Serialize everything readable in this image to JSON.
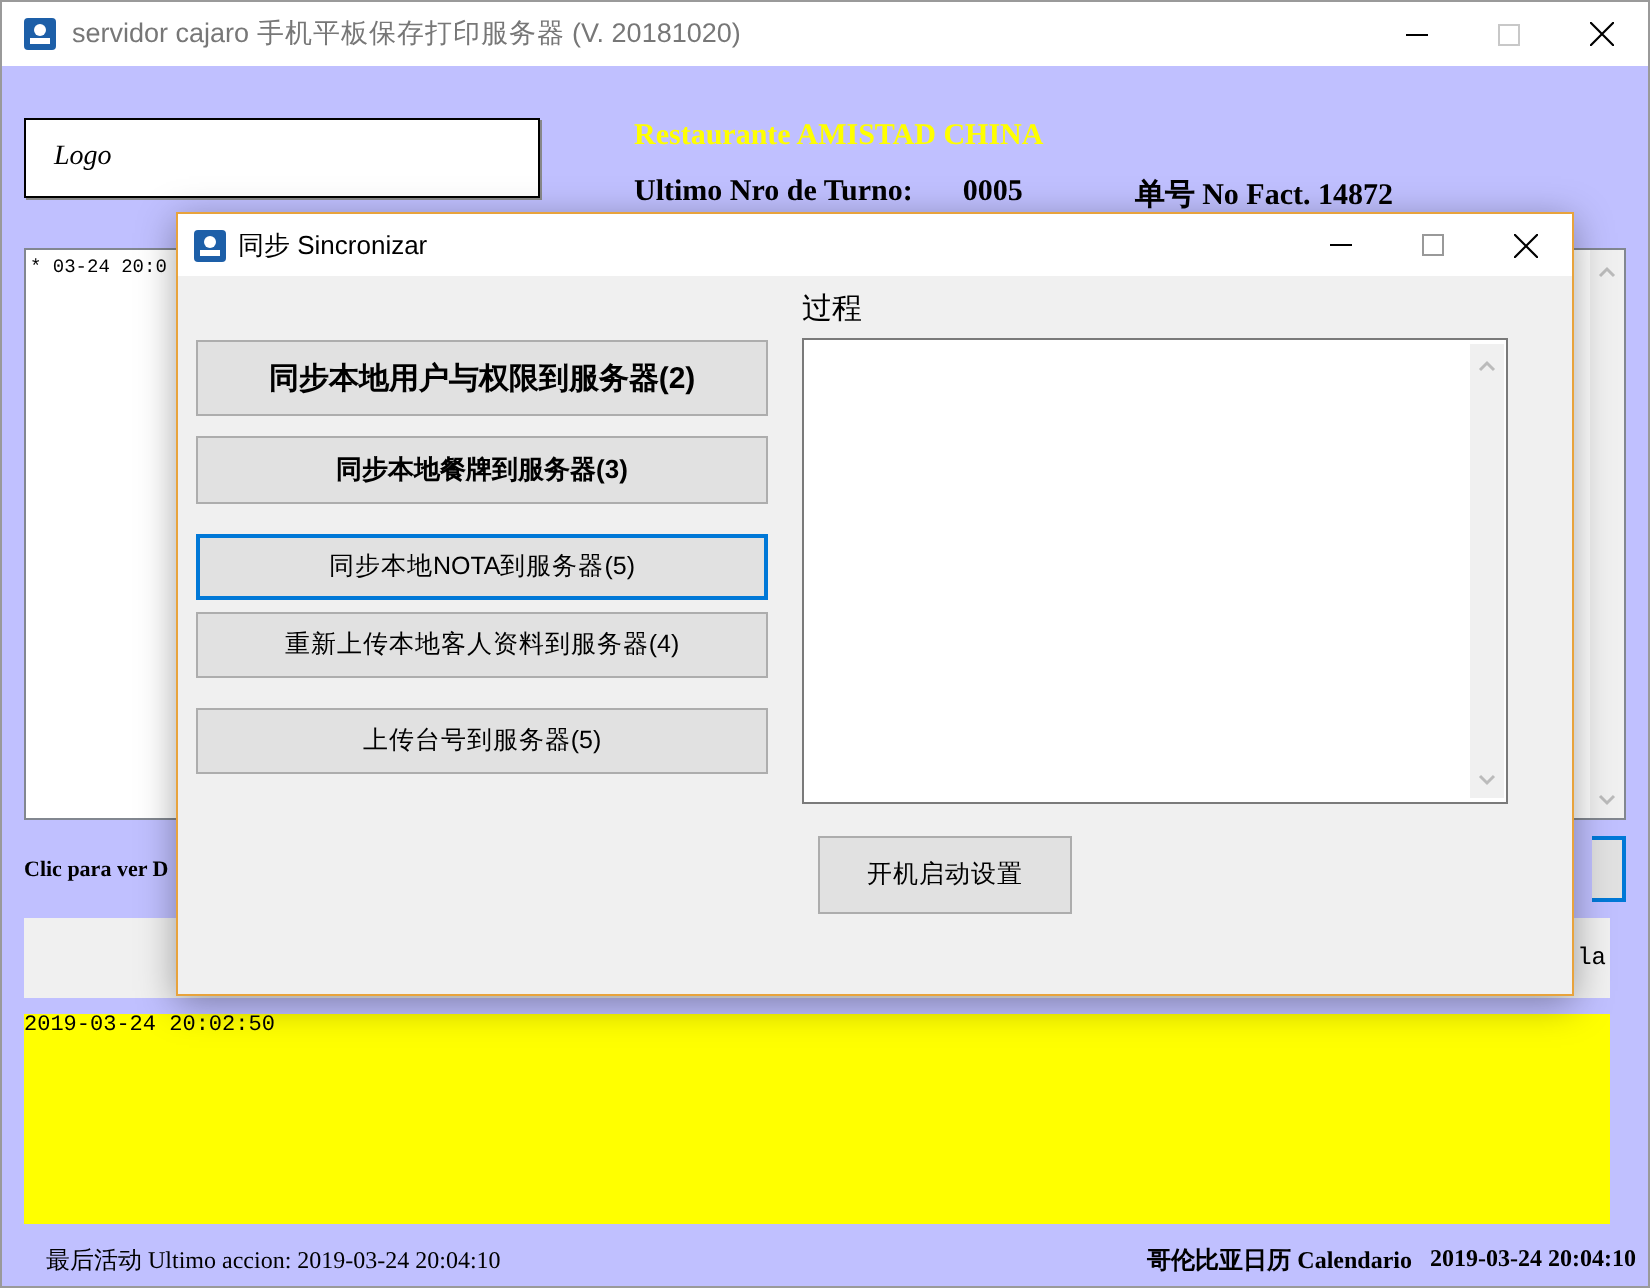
{
  "main_window": {
    "title": "servidor cajaro 手机平板保存打印服务器 (V. 20181020)",
    "logo": "Logo",
    "restaurant": "Restaurante AMISTAD CHINA",
    "turn_label": "Ultimo Nro de Turno:",
    "turn_value": "0005",
    "invoice_label": "单号 No  Fact. 14872",
    "log_lines": [
      "* 03-24 20:0"
    ],
    "details_link": "Clic para ver D",
    "info_panel_text": "la",
    "yellow_log": "2019-03-24 20:02:50",
    "status_left": "最后活动 Ultimo accion: 2019-03-24 20:04:10",
    "status_right_label": "哥伦比亚日历 Calendario",
    "status_right_time": "2019-03-24 20:04:10"
  },
  "dialog": {
    "title": "同步 Sincronizar",
    "process_label": "过程",
    "startup_button": "开机启动设置",
    "buttons": [
      {
        "label": "同步本地用户与权限到服务器(2)",
        "kind": "large-bold",
        "focused": false
      },
      {
        "label": "同步本地餐牌到服务器(3)",
        "kind": "bold",
        "focused": false
      },
      {
        "label": "同步本地NOTA到服务器(5)",
        "kind": "normal",
        "focused": true
      },
      {
        "label": "重新上传本地客人资料到服务器(4)",
        "kind": "normal",
        "focused": false
      },
      {
        "label": "上传台号到服务器(5)",
        "kind": "normal",
        "focused": false
      }
    ]
  }
}
